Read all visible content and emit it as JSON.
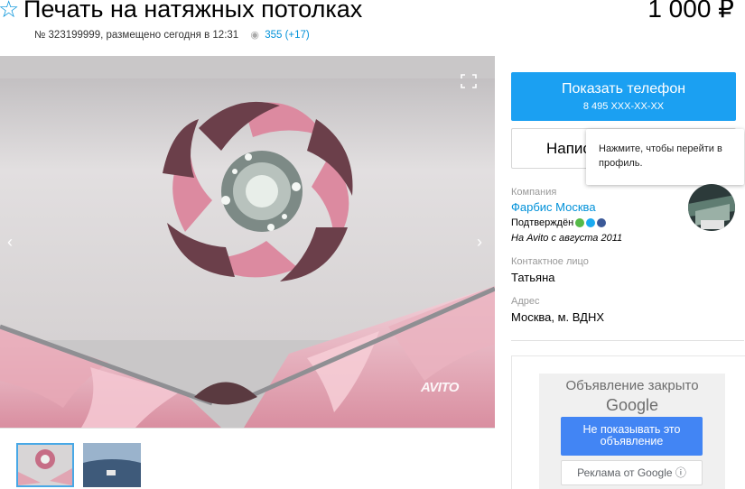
{
  "listing": {
    "title": "Печать на натяжных потолках",
    "price": "1 000 ₽",
    "number_text": "№ 323199999, размещено сегодня в 12:31",
    "views": "355 (+17)"
  },
  "gallery": {
    "watermark": "AVITO"
  },
  "contact": {
    "phone_label": "Показать телефон",
    "phone_number": "8 495 XXX-XX-XX",
    "write_label": "Напис",
    "tooltip_text": "Нажмите, чтобы перейти в профиль."
  },
  "seller": {
    "company_label": "Компания",
    "company_name": "Фарбис Москва",
    "verified_label": "Подтверждён",
    "since": "На Avito с августа 2011",
    "contact_label": "Контактное лицо",
    "contact_name": "Татьяна",
    "address_label": "Адрес",
    "address": "Москва, м. ВДНХ"
  },
  "ad": {
    "closed_text": "Объявление закрыто",
    "brand": "Google",
    "hide_button": "Не показывать это объявление",
    "by_google": "Реклама от Google ⓘ"
  },
  "colors": {
    "accent_blue": "#1ba0f2",
    "link_blue": "#0091d9",
    "google_blue": "#4285f4"
  },
  "icons": {
    "favorite": "star-outline-icon",
    "views": "eye-icon",
    "fullscreen": "fullscreen-icon",
    "prev": "chevron-left-icon",
    "next": "chevron-right-icon",
    "badges": [
      "phone-verified-icon",
      "email-verified-icon",
      "facebook-icon"
    ]
  }
}
